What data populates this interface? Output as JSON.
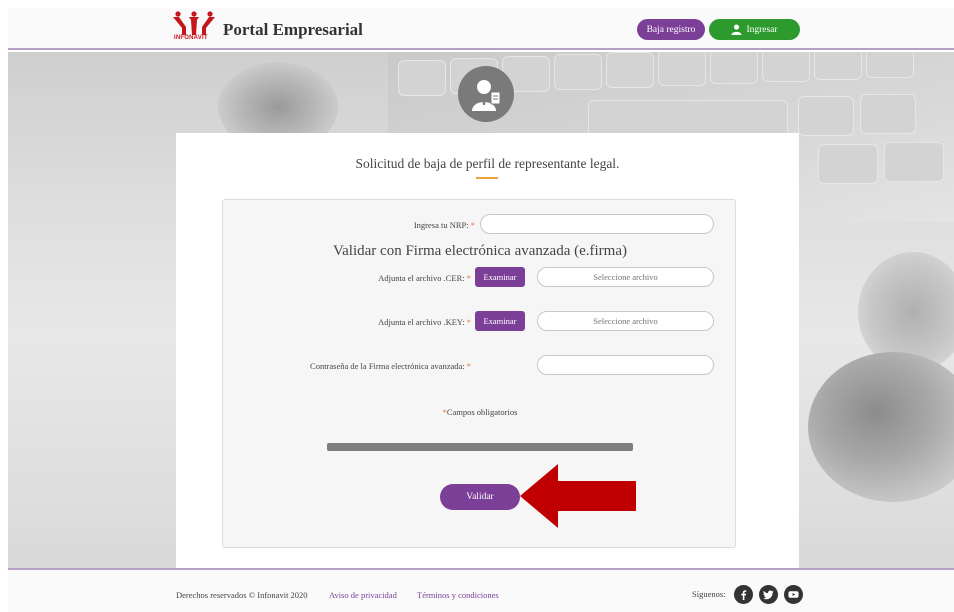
{
  "header": {
    "brand_text": "INFONAVIT",
    "title": "Portal Empresarial",
    "baja_label": "Baja registro",
    "ingresar_label": "Ingresar"
  },
  "card": {
    "title": "Solicitud de baja de perfil de representante legal.",
    "nrp_label": "Ingresa tu NRP:",
    "nrp_value": "",
    "section_title": "Validar con Firma electrónica avanzada (e.firma)",
    "cer_label": "Adjunta el archivo .CER:",
    "cer_button": "Examinar",
    "cer_placeholder": "Seleccione archivo",
    "key_label": "Adjunta el archivo .KEY:",
    "key_button": "Examinar",
    "key_placeholder": "Seleccione archivo",
    "password_label": "Contraseña de la Firma electrónica avanzada:",
    "password_value": "",
    "required_mark": "*",
    "required_note": "Campos obligatorios",
    "validar_label": "Validar"
  },
  "footer": {
    "copyright": "Derechos reservados © Infonavit 2020",
    "privacy": "Aviso de privacidad",
    "terms": "Términos y condiciones",
    "follow": "Síguenos:",
    "social_icons": [
      "facebook-icon",
      "twitter-icon",
      "youtube-icon"
    ]
  },
  "colors": {
    "purple": "#7b3f98",
    "green": "#2c9a2c",
    "red_arrow": "#c00000",
    "required": "#e8743d"
  }
}
